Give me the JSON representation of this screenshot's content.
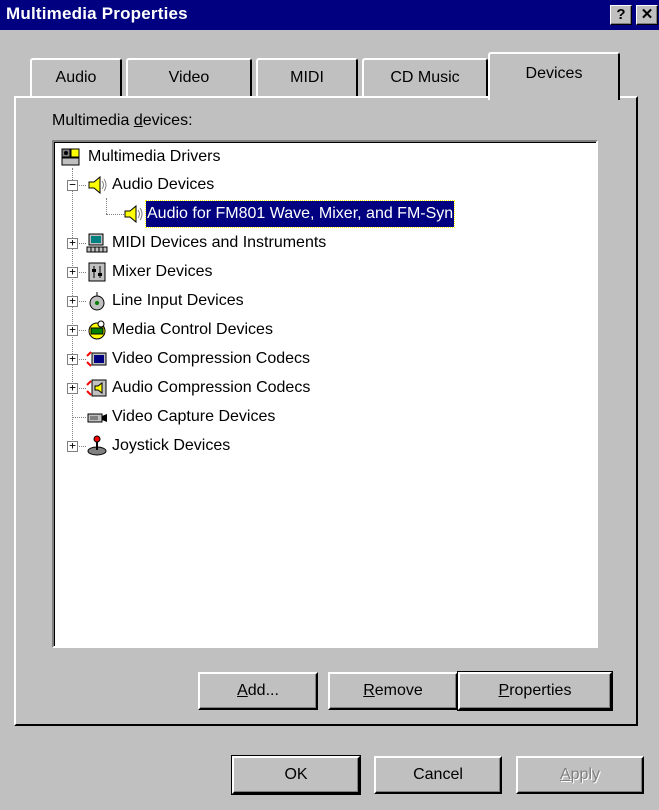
{
  "window": {
    "title": "Multimedia Properties",
    "help_glyph": "?",
    "close_glyph": "✕"
  },
  "tabs": [
    {
      "label": "Audio",
      "active": false
    },
    {
      "label": "Video",
      "active": false
    },
    {
      "label": "MIDI",
      "active": false
    },
    {
      "label": "CD Music",
      "active": false
    },
    {
      "label": "Devices",
      "active": true
    }
  ],
  "devices_label": {
    "pre": "Multimedia ",
    "accel": "d",
    "post": "evices:"
  },
  "tree": {
    "root": {
      "label": "Multimedia Drivers",
      "icon": "multimedia-drivers-icon"
    },
    "items": [
      {
        "label": "Audio Devices",
        "icon": "speaker-icon",
        "expander": "−"
      },
      {
        "label": "Audio for FM801 Wave, Mixer, and FM-Syn",
        "icon": "speaker-icon",
        "selected": true
      },
      {
        "label": "MIDI Devices and Instruments",
        "icon": "midi-computer-icon",
        "expander": "+"
      },
      {
        "label": "Mixer Devices",
        "icon": "mixer-icon",
        "expander": "+"
      },
      {
        "label": "Line Input Devices",
        "icon": "line-input-icon",
        "expander": "+"
      },
      {
        "label": "Media Control Devices",
        "icon": "media-control-icon",
        "expander": "+"
      },
      {
        "label": "Video Compression Codecs",
        "icon": "video-codec-icon",
        "expander": "+"
      },
      {
        "label": "Audio Compression Codecs",
        "icon": "audio-codec-icon",
        "expander": "+"
      },
      {
        "label": "Video Capture Devices",
        "icon": "video-capture-icon"
      },
      {
        "label": "Joystick Devices",
        "icon": "joystick-icon",
        "expander": "+"
      }
    ]
  },
  "panel_buttons": {
    "add": {
      "accel": "A",
      "rest": "dd..."
    },
    "remove": {
      "accel": "R",
      "rest": "emove"
    },
    "properties": {
      "accel": "P",
      "rest": "roperties"
    }
  },
  "dialog_buttons": {
    "ok": "OK",
    "cancel": "Cancel",
    "apply": {
      "accel": "A",
      "rest": "pply",
      "disabled": true
    }
  },
  "colors": {
    "face": "#c0c0c0",
    "title_bar": "#000080",
    "selection": "#000080"
  }
}
